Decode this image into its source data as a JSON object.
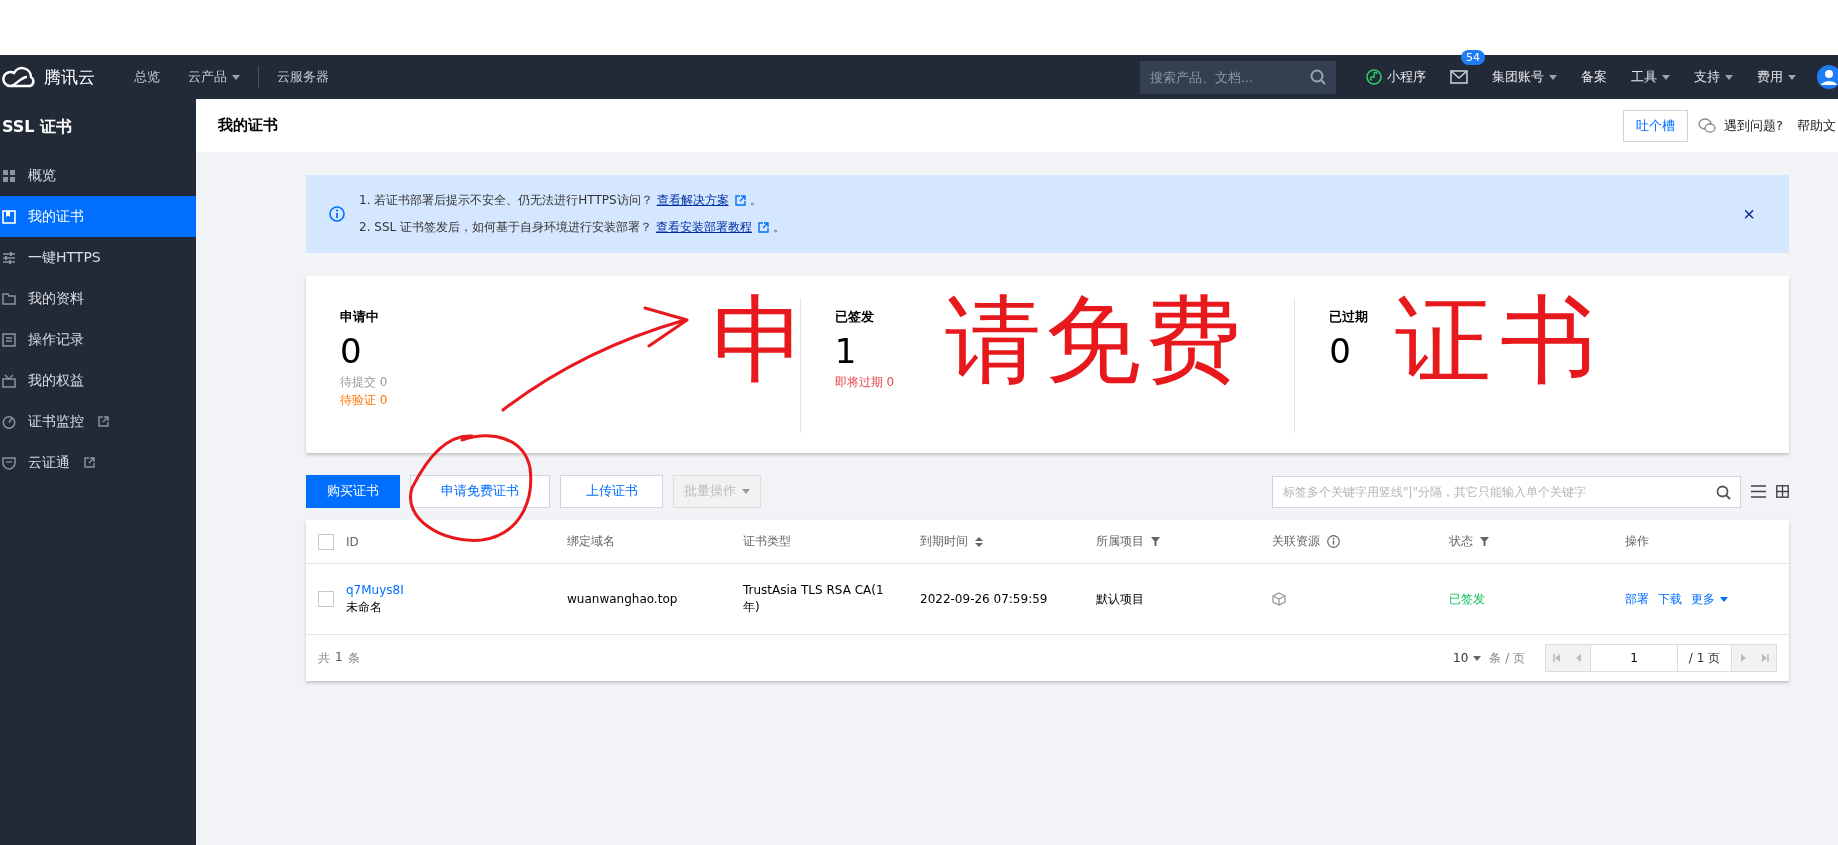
{
  "topnav": {
    "logo": "腾讯云",
    "links": [
      {
        "label": "总览",
        "dropdown": false
      },
      {
        "label": "云产品",
        "dropdown": true
      },
      {
        "label": "云服务器",
        "dropdown": false
      }
    ],
    "search": {
      "placeholder": "搜索产品、文档..."
    },
    "right": [
      {
        "kind": "miniapp",
        "label": "小程序"
      },
      {
        "kind": "mail",
        "badge": "54"
      },
      {
        "kind": "menu",
        "label": "集团账号",
        "dropdown": true
      },
      {
        "kind": "menu",
        "label": "备案",
        "dropdown": false
      },
      {
        "kind": "menu",
        "label": "工具",
        "dropdown": true
      },
      {
        "kind": "menu",
        "label": "支持",
        "dropdown": true
      },
      {
        "kind": "menu",
        "label": "费用",
        "dropdown": true
      },
      {
        "kind": "avatar"
      }
    ]
  },
  "sidebar": {
    "title": "SSL 证书",
    "items": [
      {
        "label": "概览",
        "external": false,
        "selected": false
      },
      {
        "label": "我的证书",
        "external": false,
        "selected": true
      },
      {
        "label": "一键HTTPS",
        "external": false,
        "selected": false
      },
      {
        "label": "我的资料",
        "external": false,
        "selected": false
      },
      {
        "label": "操作记录",
        "external": false,
        "selected": false
      },
      {
        "label": "我的权益",
        "external": false,
        "selected": false
      },
      {
        "label": "证书监控",
        "external": true,
        "selected": false
      },
      {
        "label": "云证通",
        "external": true,
        "selected": false
      }
    ]
  },
  "header": {
    "title": "我的证书",
    "feedback_button": "吐个槽",
    "help": "遇到问题?",
    "docs": "帮助文"
  },
  "notice": {
    "lines": [
      {
        "text": "1. 若证书部署后提示不安全、仍无法进行HTTPS访问？",
        "link": "查看解决方案",
        "end": "。"
      },
      {
        "text": "2. SSL 证书签发后，如何基于自身环境进行安装部署？",
        "link": "查看安装部署教程",
        "end": "。"
      }
    ],
    "close": "×"
  },
  "stats": [
    {
      "title": "申请中",
      "value": "0",
      "details": [
        {
          "text": "待提交 0",
          "kind": "muted"
        },
        {
          "text": "待验证 0",
          "kind": "warning"
        }
      ]
    },
    {
      "title": "已签发",
      "value": "1",
      "details": [
        {
          "text": "即将过期 0",
          "kind": "danger"
        }
      ]
    },
    {
      "title": "已过期",
      "value": "0"
    }
  ],
  "toolbar": {
    "buttons": [
      {
        "label": "购买证书",
        "kind": "primary",
        "disabled": false
      },
      {
        "label": "申请免费证书",
        "kind": "default",
        "disabled": false
      },
      {
        "label": "上传证书",
        "kind": "default",
        "disabled": false
      },
      {
        "label": "批量操作",
        "kind": "dropdown",
        "disabled": true
      }
    ],
    "search": {
      "placeholder": "标签多个关键字用竖线\"|\"分隔，其它只能输入单个关键字"
    }
  },
  "table": {
    "select_all_checked": false,
    "columns": [
      {
        "label": "ID"
      },
      {
        "label": "绑定域名"
      },
      {
        "label": "证书类型"
      },
      {
        "label": "到期时间"
      },
      {
        "label": "所属项目"
      },
      {
        "label": "关联资源"
      },
      {
        "label": "状态"
      },
      {
        "label": "操作"
      }
    ],
    "rows": [
      {
        "checked": false,
        "id": "q7Muys8I",
        "name": "未命名",
        "domain": "wuanwanghao.top",
        "type": "TrustAsia TLS RSA CA(1年)",
        "expires": "2022-09-26 07:59:59",
        "project": "默认项目",
        "status": "已签发",
        "actions": [
          {
            "label": "部署",
            "dropdown": false
          },
          {
            "label": "下载",
            "dropdown": false
          },
          {
            "label": "更多",
            "dropdown": true
          }
        ]
      }
    ],
    "total": {
      "prefix": "共",
      "count": "1",
      "suffix": "条"
    },
    "page_size": "10",
    "page_size_unit": "条 / 页",
    "page": "1",
    "page_total": "/ 1 页"
  },
  "annotation": {
    "handwriting": [
      "申",
      "请",
      "免",
      "费",
      "证",
      "书"
    ]
  }
}
